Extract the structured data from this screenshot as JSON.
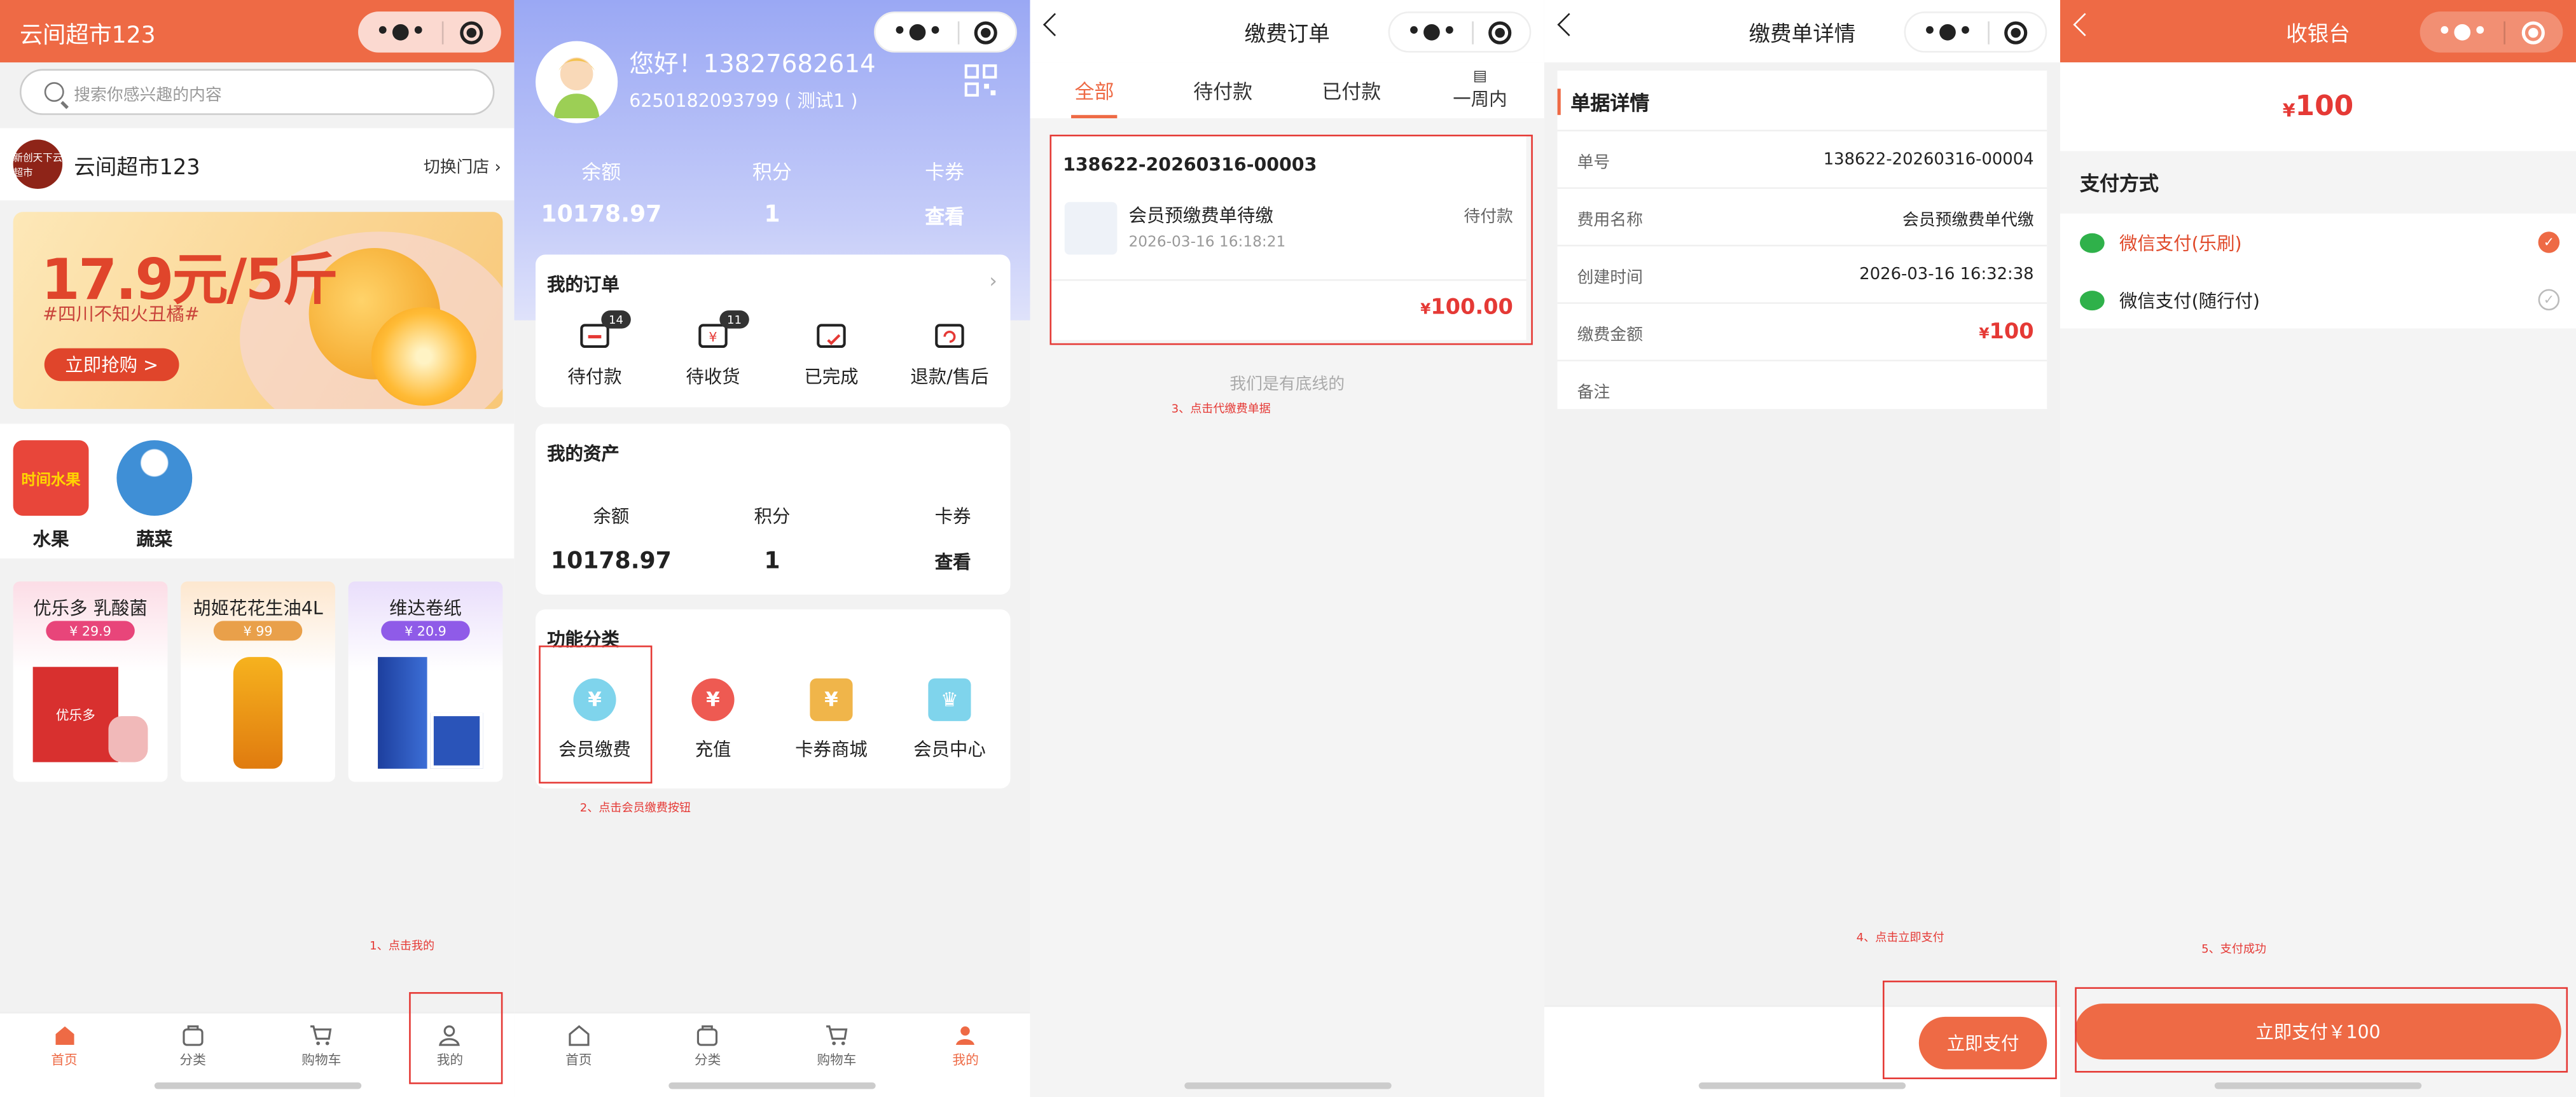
{
  "colors": {
    "accent": "#ee6a45",
    "price_red": "#e53935",
    "annotation_red": "#e53935",
    "wechat_green": "#2fb14a"
  },
  "tabbar": [
    {
      "label": "首页",
      "icon": "home-icon"
    },
    {
      "label": "分类",
      "icon": "category-icon"
    },
    {
      "label": "购物车",
      "icon": "cart-icon"
    },
    {
      "label": "我的",
      "icon": "user-icon"
    }
  ],
  "p1": {
    "title": "云间超市123",
    "search_placeholder": "搜索你感兴趣的内容",
    "store_logo_text": "新创天下云超市",
    "store_name": "云间超市123",
    "switch_store": "切换门店",
    "banner_price": "17.9元/5斤",
    "banner_sub": "#四川不知火丑橘#",
    "banner_button": "立即抢购 >",
    "categories": [
      "水果",
      "蔬菜"
    ],
    "fruit_logo_text": "时间水果",
    "products": [
      {
        "name": "优乐多 乳酸菌",
        "price": "¥ 29.9",
        "brand": "优乐多"
      },
      {
        "name": "胡姬花花生油4L",
        "price": "¥ 99"
      },
      {
        "name": "维达卷纸",
        "price": "¥ 20.9"
      }
    ],
    "annotation": "1、点击我的"
  },
  "p2": {
    "greeting": "您好！13827682614",
    "card_number": "6250182093799 ( 测试1 )",
    "stats": [
      {
        "label": "余额",
        "value": "10178.97"
      },
      {
        "label": "积分",
        "value": "1"
      },
      {
        "label": "卡券",
        "value": "查看"
      }
    ],
    "orders_title": "我的订单",
    "orders": [
      {
        "label": "待付款",
        "badge": "14"
      },
      {
        "label": "待收货",
        "badge": "11"
      },
      {
        "label": "已完成"
      },
      {
        "label": "退款/售后"
      }
    ],
    "assets_title": "我的资产",
    "assets": [
      {
        "label": "余额",
        "value": "10178.97"
      },
      {
        "label": "积分",
        "value": "1"
      },
      {
        "label": "卡券",
        "value": "查看"
      }
    ],
    "functions_title": "功能分类",
    "functions": [
      {
        "label": "会员缴费",
        "glyph": "¥"
      },
      {
        "label": "充值",
        "glyph": "¥"
      },
      {
        "label": "卡券商城",
        "glyph": "¥"
      },
      {
        "label": "会员中心",
        "glyph": "♛"
      }
    ],
    "annotation": "2、点击会员缴费按钮"
  },
  "p3": {
    "title": "缴费订单",
    "tabs": [
      "全部",
      "待付款",
      "已付款",
      "一周内"
    ],
    "order": {
      "no": "138622-20260316-00003",
      "name": "会员预缴费单待缴",
      "status": "待付款",
      "time": "2026-03-16 16:18:21",
      "amount": "100.00",
      "currency": "¥"
    },
    "bottom_line": "我们是有底线的",
    "annotation": "3、点击代缴费单据"
  },
  "p4": {
    "title": "缴费单详情",
    "section": "单据详情",
    "rows": [
      {
        "k": "单号",
        "v": "138622-20260316-00004"
      },
      {
        "k": "费用名称",
        "v": "会员预缴费单代缴"
      },
      {
        "k": "创建时间",
        "v": "2026-03-16 16:32:38"
      },
      {
        "k": "缴费金额",
        "v": "100",
        "currency": "¥"
      },
      {
        "k": "备注",
        "v": ""
      }
    ],
    "pay_button": "立即支付",
    "annotation": "4、点击立即支付"
  },
  "p5": {
    "title": "收银台",
    "amount": "100",
    "currency": "¥",
    "method_title": "支付方式",
    "methods": [
      {
        "label": "微信支付(乐刷)",
        "selected": true
      },
      {
        "label": "微信支付(随行付)",
        "selected": false
      }
    ],
    "pay_button": "立即支付￥100",
    "annotation": "5、支付成功"
  }
}
